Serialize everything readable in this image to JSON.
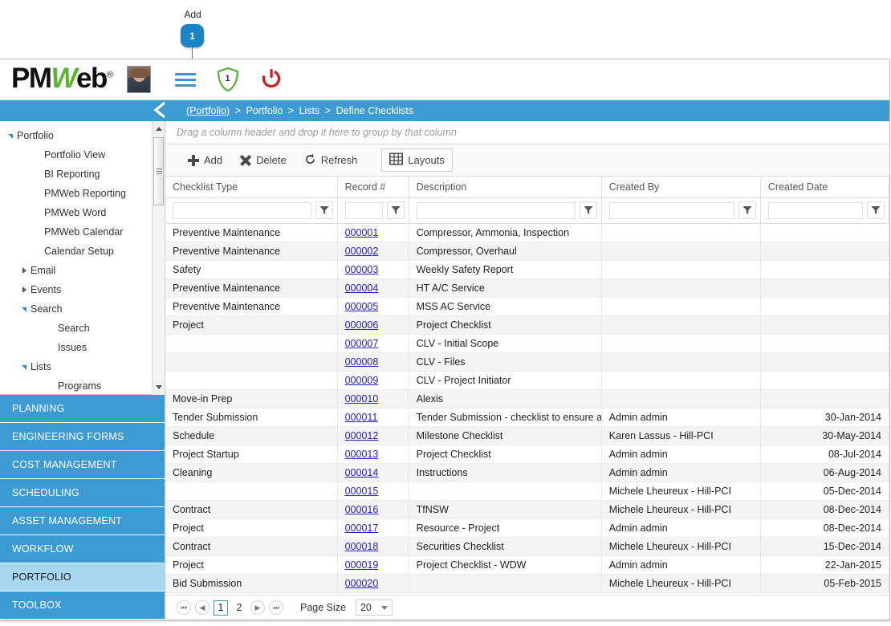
{
  "annotation": {
    "label": "Add",
    "badge": "1"
  },
  "header": {
    "logo_pm": "PM",
    "logo_w": "W",
    "logo_eb": "eb",
    "logo_reg": "®",
    "avatar_name": "user-avatar",
    "shield_count": "1"
  },
  "breadcrumb": {
    "items": [
      "(Portfolio)",
      "Portfolio",
      "Lists",
      "Define Checklists"
    ],
    "separator": ">"
  },
  "sidebar": {
    "tree": [
      {
        "label": "Portfolio",
        "indent": 0,
        "arrow": "open"
      },
      {
        "label": "Portfolio View",
        "indent": 2,
        "arrow": "none"
      },
      {
        "label": "BI Reporting",
        "indent": 2,
        "arrow": "none"
      },
      {
        "label": "PMWeb Reporting",
        "indent": 2,
        "arrow": "none"
      },
      {
        "label": "PMWeb Word",
        "indent": 2,
        "arrow": "none"
      },
      {
        "label": "PMWeb Calendar",
        "indent": 2,
        "arrow": "none"
      },
      {
        "label": "Calendar Setup",
        "indent": 2,
        "arrow": "none"
      },
      {
        "label": "Email",
        "indent": 1,
        "arrow": "closed"
      },
      {
        "label": "Events",
        "indent": 1,
        "arrow": "closed"
      },
      {
        "label": "Search",
        "indent": 1,
        "arrow": "open"
      },
      {
        "label": "Search",
        "indent": 3,
        "arrow": "none"
      },
      {
        "label": "Issues",
        "indent": 3,
        "arrow": "none"
      },
      {
        "label": "Lists",
        "indent": 1,
        "arrow": "open"
      },
      {
        "label": "Programs",
        "indent": 3,
        "arrow": "none"
      }
    ],
    "modules": [
      {
        "label": "PLANNING",
        "active": false
      },
      {
        "label": "ENGINEERING FORMS",
        "active": false
      },
      {
        "label": "COST MANAGEMENT",
        "active": false
      },
      {
        "label": "SCHEDULING",
        "active": false
      },
      {
        "label": "ASSET MANAGEMENT",
        "active": false
      },
      {
        "label": "WORKFLOW",
        "active": false
      },
      {
        "label": "PORTFOLIO",
        "active": true
      },
      {
        "label": "TOOLBOX",
        "active": false
      }
    ]
  },
  "grid": {
    "group_hint": "Drag a column header and drop it here to group by that column",
    "toolbar": {
      "add": "Add",
      "delete": "Delete",
      "refresh": "Refresh",
      "layouts": "Layouts"
    },
    "columns": [
      "Checklist Type",
      "Record #",
      "Description",
      "Created By",
      "Created Date"
    ],
    "filters": [
      "",
      "",
      "",
      "",
      ""
    ],
    "rows": [
      {
        "type": "Preventive Maintenance",
        "record": "000001",
        "desc": "Compressor, Ammonia, Inspection",
        "by": "",
        "date": ""
      },
      {
        "type": "Preventive Maintenance",
        "record": "000002",
        "desc": "Compressor, Overhaul",
        "by": "",
        "date": ""
      },
      {
        "type": "Safety",
        "record": "000003",
        "desc": "Weekly Safety Report",
        "by": "",
        "date": ""
      },
      {
        "type": "Preventive Maintenance",
        "record": "000004",
        "desc": "HT A/C Service",
        "by": "",
        "date": ""
      },
      {
        "type": "Preventive Maintenance",
        "record": "000005",
        "desc": "MSS AC Service",
        "by": "",
        "date": ""
      },
      {
        "type": "Project",
        "record": "000006",
        "desc": "Project Checklist",
        "by": "",
        "date": ""
      },
      {
        "type": "",
        "record": "000007",
        "desc": "CLV - Initial Scope",
        "by": "",
        "date": ""
      },
      {
        "type": "",
        "record": "000008",
        "desc": "CLV - Files",
        "by": "",
        "date": ""
      },
      {
        "type": "",
        "record": "000009",
        "desc": "CLV - Project Initiator",
        "by": "",
        "date": ""
      },
      {
        "type": "Move-in Prep",
        "record": "000010",
        "desc": "Alexis",
        "by": "",
        "date": ""
      },
      {
        "type": "Tender Submission",
        "record": "000011",
        "desc": "Tender Submission - checklist to ensure all",
        "by": "Admin admin",
        "date": "30-Jan-2014"
      },
      {
        "type": "Schedule",
        "record": "000012",
        "desc": "Milestone Checklist",
        "by": "Karen Lassus - Hill-PCI",
        "date": "30-May-2014"
      },
      {
        "type": "Project Startup",
        "record": "000013",
        "desc": "Project Checklist",
        "by": "Admin admin",
        "date": "08-Jul-2014"
      },
      {
        "type": "Cleaning",
        "record": "000014",
        "desc": "Instructions",
        "by": "Admin admin",
        "date": "06-Aug-2014"
      },
      {
        "type": "",
        "record": "000015",
        "desc": "",
        "by": "Michele Lheureux - Hill-PCI",
        "date": "05-Dec-2014"
      },
      {
        "type": "Contract",
        "record": "000016",
        "desc": "TfNSW",
        "by": "Michele Lheureux - Hill-PCI",
        "date": "08-Dec-2014"
      },
      {
        "type": "Project",
        "record": "000017",
        "desc": "Resource - Project",
        "by": "Admin admin",
        "date": "08-Dec-2014"
      },
      {
        "type": "Contract",
        "record": "000018",
        "desc": "Securities Checklist",
        "by": "Michele Lheureux - Hill-PCI",
        "date": "15-Dec-2014"
      },
      {
        "type": "Project",
        "record": "000019",
        "desc": "Project Checklist - WDW",
        "by": "Admin admin",
        "date": "22-Jan-2015"
      },
      {
        "type": "Bid Submission",
        "record": "000020",
        "desc": "",
        "by": "Michele Lheureux - Hill-PCI",
        "date": "05-Feb-2015"
      }
    ]
  },
  "pager": {
    "pages": [
      "1",
      "2"
    ],
    "current_page": "1",
    "page_size_label": "Page Size",
    "page_size_value": "20"
  },
  "colors": {
    "accent_blue": "#3d9bd4",
    "active_module": "#a7d6ef",
    "link_blue": "#2222cc",
    "logo_green": "#5ab531",
    "power_red": "#cc2222"
  }
}
